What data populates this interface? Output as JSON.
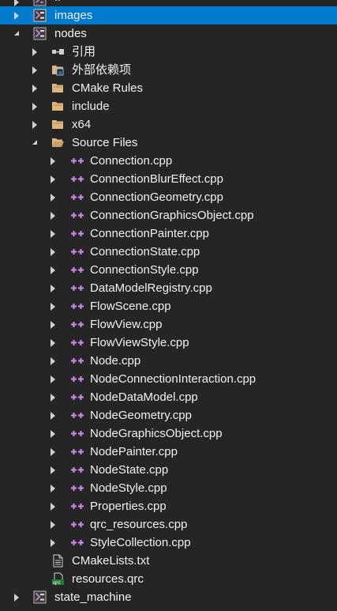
{
  "tree": {
    "top_partial": {
      "label": "ff"
    },
    "images": {
      "label": "images"
    },
    "nodes": {
      "label": "nodes",
      "children": {
        "references": {
          "label": "引用"
        },
        "external_deps": {
          "label": "外部依赖项"
        },
        "cmake_rules": {
          "label": "CMake Rules"
        },
        "include": {
          "label": "include"
        },
        "x64": {
          "label": "x64"
        },
        "source_files": {
          "label": "Source Files",
          "files": [
            "Connection.cpp",
            "ConnectionBlurEffect.cpp",
            "ConnectionGeometry.cpp",
            "ConnectionGraphicsObject.cpp",
            "ConnectionPainter.cpp",
            "ConnectionState.cpp",
            "ConnectionStyle.cpp",
            "DataModelRegistry.cpp",
            "FlowScene.cpp",
            "FlowView.cpp",
            "FlowViewStyle.cpp",
            "Node.cpp",
            "NodeConnectionInteraction.cpp",
            "NodeDataModel.cpp",
            "NodeGeometry.cpp",
            "NodeGraphicsObject.cpp",
            "NodePainter.cpp",
            "NodeState.cpp",
            "NodeStyle.cpp",
            "Properties.cpp",
            "qrc_resources.cpp",
            "StyleCollection.cpp"
          ]
        },
        "cmakelists": {
          "label": "CMakeLists.txt"
        },
        "resources": {
          "label": "resources.qrc",
          "badge": "qrc"
        }
      }
    },
    "state_machine": {
      "label": "state_machine"
    }
  },
  "colors": {
    "background": "#252526",
    "selection": "#007acc",
    "text": "#f1f1f1",
    "cpp_icon": "#c586e0",
    "folder_icon": "#dcb67a",
    "project_icon": "#b180d7"
  }
}
